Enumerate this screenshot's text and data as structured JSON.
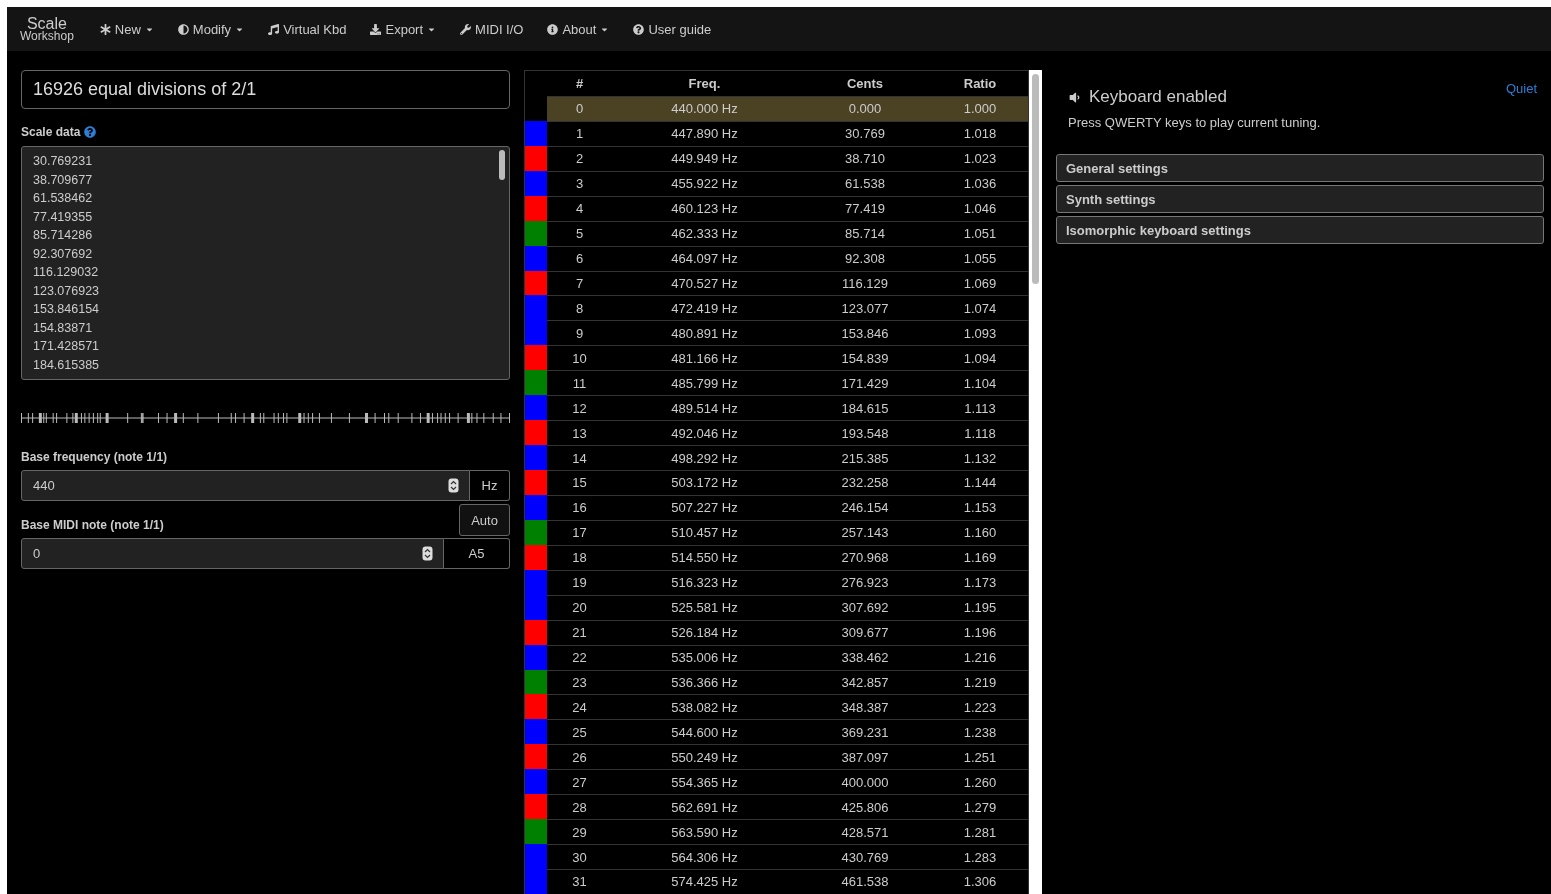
{
  "navbar": {
    "brand": {
      "top": "Scale",
      "bottom": "Workshop"
    },
    "items": [
      {
        "label": "New",
        "dropdown": true
      },
      {
        "label": "Modify",
        "dropdown": true
      },
      {
        "label": "Virtual Kbd",
        "dropdown": false
      },
      {
        "label": "Export",
        "dropdown": true
      },
      {
        "label": "MIDI I/O",
        "dropdown": false
      },
      {
        "label": "About",
        "dropdown": true
      },
      {
        "label": "User guide",
        "dropdown": false
      }
    ]
  },
  "scale": {
    "name": "16926 equal divisions of 2/1",
    "data_label": "Scale data",
    "data_lines": [
      "30.769231",
      "38.709677",
      "61.538462",
      "77.419355",
      "85.714286",
      "92.307692",
      "116.129032",
      "123.076923",
      "153.846154",
      "154.83871",
      "171.428571",
      "184.615385"
    ]
  },
  "base_frequency": {
    "label": "Base frequency (note 1/1)",
    "value": "440",
    "unit": "Hz"
  },
  "base_midi": {
    "label": "Base MIDI note (note 1/1)",
    "auto_button": "Auto",
    "value": "0",
    "note": "A5"
  },
  "table": {
    "columns": [
      "#",
      "Freq.",
      "Cents",
      "Ratio"
    ],
    "rows": [
      {
        "n": "0",
        "freq": "440.000 Hz",
        "cents": "0.000",
        "ratio": "1.000",
        "color": "#000000",
        "selected": true
      },
      {
        "n": "1",
        "freq": "447.890 Hz",
        "cents": "30.769",
        "ratio": "1.018",
        "color": "#0000ff",
        "selected": false
      },
      {
        "n": "2",
        "freq": "449.949 Hz",
        "cents": "38.710",
        "ratio": "1.023",
        "color": "#ff0000",
        "selected": false
      },
      {
        "n": "3",
        "freq": "455.922 Hz",
        "cents": "61.538",
        "ratio": "1.036",
        "color": "#0000ff",
        "selected": false
      },
      {
        "n": "4",
        "freq": "460.123 Hz",
        "cents": "77.419",
        "ratio": "1.046",
        "color": "#ff0000",
        "selected": false
      },
      {
        "n": "5",
        "freq": "462.333 Hz",
        "cents": "85.714",
        "ratio": "1.051",
        "color": "#008000",
        "selected": false
      },
      {
        "n": "6",
        "freq": "464.097 Hz",
        "cents": "92.308",
        "ratio": "1.055",
        "color": "#0000ff",
        "selected": false
      },
      {
        "n": "7",
        "freq": "470.527 Hz",
        "cents": "116.129",
        "ratio": "1.069",
        "color": "#ff0000",
        "selected": false
      },
      {
        "n": "8",
        "freq": "472.419 Hz",
        "cents": "123.077",
        "ratio": "1.074",
        "color": "#0000ff",
        "selected": false
      },
      {
        "n": "9",
        "freq": "480.891 Hz",
        "cents": "153.846",
        "ratio": "1.093",
        "color": "#0000ff",
        "selected": false
      },
      {
        "n": "10",
        "freq": "481.166 Hz",
        "cents": "154.839",
        "ratio": "1.094",
        "color": "#ff0000",
        "selected": false
      },
      {
        "n": "11",
        "freq": "485.799 Hz",
        "cents": "171.429",
        "ratio": "1.104",
        "color": "#008000",
        "selected": false
      },
      {
        "n": "12",
        "freq": "489.514 Hz",
        "cents": "184.615",
        "ratio": "1.113",
        "color": "#0000ff",
        "selected": false
      },
      {
        "n": "13",
        "freq": "492.046 Hz",
        "cents": "193.548",
        "ratio": "1.118",
        "color": "#ff0000",
        "selected": false
      },
      {
        "n": "14",
        "freq": "498.292 Hz",
        "cents": "215.385",
        "ratio": "1.132",
        "color": "#0000ff",
        "selected": false
      },
      {
        "n": "15",
        "freq": "503.172 Hz",
        "cents": "232.258",
        "ratio": "1.144",
        "color": "#ff0000",
        "selected": false
      },
      {
        "n": "16",
        "freq": "507.227 Hz",
        "cents": "246.154",
        "ratio": "1.153",
        "color": "#0000ff",
        "selected": false
      },
      {
        "n": "17",
        "freq": "510.457 Hz",
        "cents": "257.143",
        "ratio": "1.160",
        "color": "#008000",
        "selected": false
      },
      {
        "n": "18",
        "freq": "514.550 Hz",
        "cents": "270.968",
        "ratio": "1.169",
        "color": "#ff0000",
        "selected": false
      },
      {
        "n": "19",
        "freq": "516.323 Hz",
        "cents": "276.923",
        "ratio": "1.173",
        "color": "#0000ff",
        "selected": false
      },
      {
        "n": "20",
        "freq": "525.581 Hz",
        "cents": "307.692",
        "ratio": "1.195",
        "color": "#0000ff",
        "selected": false
      },
      {
        "n": "21",
        "freq": "526.184 Hz",
        "cents": "309.677",
        "ratio": "1.196",
        "color": "#ff0000",
        "selected": false
      },
      {
        "n": "22",
        "freq": "535.006 Hz",
        "cents": "338.462",
        "ratio": "1.216",
        "color": "#0000ff",
        "selected": false
      },
      {
        "n": "23",
        "freq": "536.366 Hz",
        "cents": "342.857",
        "ratio": "1.219",
        "color": "#008000",
        "selected": false
      },
      {
        "n": "24",
        "freq": "538.082 Hz",
        "cents": "348.387",
        "ratio": "1.223",
        "color": "#ff0000",
        "selected": false
      },
      {
        "n": "25",
        "freq": "544.600 Hz",
        "cents": "369.231",
        "ratio": "1.238",
        "color": "#0000ff",
        "selected": false
      },
      {
        "n": "26",
        "freq": "550.249 Hz",
        "cents": "387.097",
        "ratio": "1.251",
        "color": "#ff0000",
        "selected": false
      },
      {
        "n": "27",
        "freq": "554.365 Hz",
        "cents": "400.000",
        "ratio": "1.260",
        "color": "#0000ff",
        "selected": false
      },
      {
        "n": "28",
        "freq": "562.691 Hz",
        "cents": "425.806",
        "ratio": "1.279",
        "color": "#ff0000",
        "selected": false
      },
      {
        "n": "29",
        "freq": "563.590 Hz",
        "cents": "428.571",
        "ratio": "1.281",
        "color": "#008000",
        "selected": false
      },
      {
        "n": "30",
        "freq": "564.306 Hz",
        "cents": "430.769",
        "ratio": "1.283",
        "color": "#0000ff",
        "selected": false
      },
      {
        "n": "31",
        "freq": "574.425 Hz",
        "cents": "461.538",
        "ratio": "1.306",
        "color": "#0000ff",
        "selected": false
      }
    ]
  },
  "keyboard": {
    "title": "Keyboard enabled",
    "quiet_link": "Quiet",
    "hint": "Press QWERTY keys to play current tuning."
  },
  "panels": [
    {
      "title": "General settings"
    },
    {
      "title": "Synth settings"
    },
    {
      "title": "Isomorphic keyboard settings"
    }
  ]
}
